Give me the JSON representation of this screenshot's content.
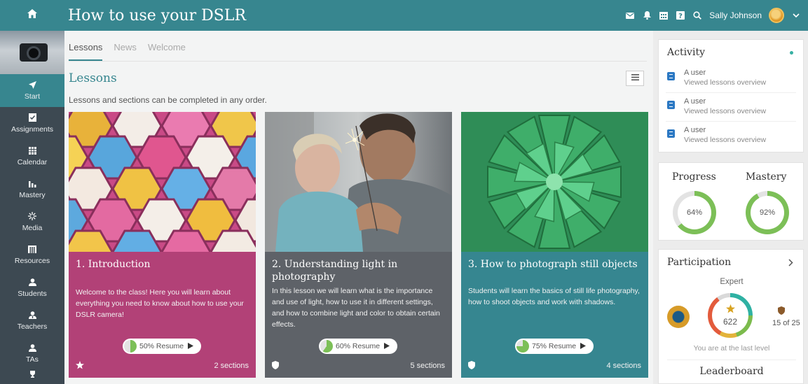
{
  "app": {
    "course_title": "How to use your DSLR",
    "user_name": "Sally Johnson"
  },
  "topbar_icons": [
    "home-icon",
    "mail-icon",
    "bell-icon",
    "calendar-icon",
    "help-icon",
    "search-icon",
    "user-avatar",
    "chevron-down-icon"
  ],
  "sidebar": {
    "items": [
      {
        "label": "Start",
        "icon": "send-icon",
        "active": true
      },
      {
        "label": "Assignments",
        "icon": "checklist-icon"
      },
      {
        "label": "Calendar",
        "icon": "calendar-icon"
      },
      {
        "label": "Mastery",
        "icon": "bar-chart-icon"
      },
      {
        "label": "Media",
        "icon": "media-icon"
      },
      {
        "label": "Resources",
        "icon": "resources-icon"
      },
      {
        "label": "Students",
        "icon": "user-icon"
      },
      {
        "label": "Teachers",
        "icon": "teacher-icon"
      },
      {
        "label": "TAs",
        "icon": "ta-icon"
      }
    ]
  },
  "main": {
    "tabs": [
      {
        "label": "Lessons",
        "active": true
      },
      {
        "label": "News"
      },
      {
        "label": "Welcome"
      }
    ],
    "section_title": "Lessons",
    "subtitle": "Lessons and sections can be completed in any order.",
    "lessons": [
      {
        "title": "1. Introduction",
        "description": "Welcome to the class! Here you will learn about everything you need to know about how to use your DSLR camera!",
        "progress_percent": 50,
        "resume_label": "50% Resume",
        "sections": "2 sections",
        "status_icon": "star-icon",
        "color": "#b24177"
      },
      {
        "title": "2. Understanding light in photography",
        "description": "In this lesson we will learn what is the importance and use of light, how to use it in different settings, and how to combine light and color to obtain certain effects.",
        "progress_percent": 60,
        "resume_label": "60% Resume",
        "sections": "5 sections",
        "status_icon": "shield-icon",
        "color": "#5e6268"
      },
      {
        "title": "3. How to photograph still objects",
        "description": "Students will learn the basics of still life photography, how to shoot objects and work with shadows.",
        "progress_percent": 75,
        "resume_label": "75% Resume",
        "sections": "4 sections",
        "status_icon": "shield-icon",
        "color": "#368690"
      }
    ]
  },
  "activity": {
    "title": "Activity",
    "items": [
      {
        "user": "A user",
        "text": "Viewed lessons overview"
      },
      {
        "user": "A user",
        "text": "Viewed lessons overview"
      },
      {
        "user": "A user",
        "text": "Viewed lessons overview"
      }
    ]
  },
  "stats": {
    "progress_label": "Progress",
    "progress_value": "64%",
    "progress_percent": 64,
    "mastery_label": "Mastery",
    "mastery_value": "92%",
    "mastery_percent": 92,
    "ring_color": "#7cbf57"
  },
  "participation": {
    "title": "Participation",
    "level": "Expert",
    "points": "622",
    "rank": "15 of 25",
    "note": "You are at the last level",
    "leaderboard_title": "Leaderboard"
  }
}
